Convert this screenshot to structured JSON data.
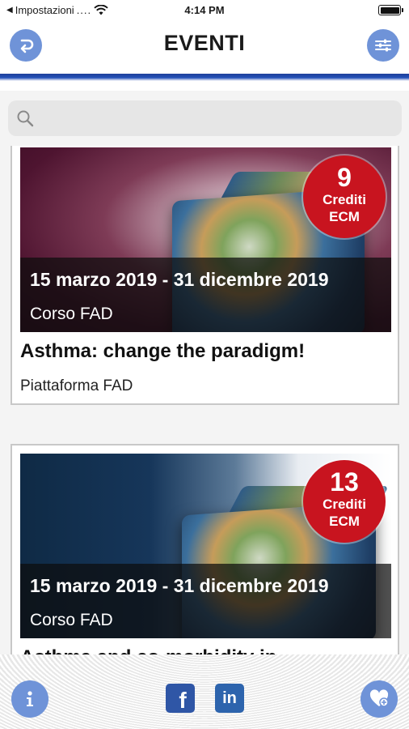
{
  "status_bar": {
    "carrier": "Impostazioni",
    "signal": "....",
    "time": "4:14 PM",
    "battery_level": 1.0
  },
  "header": {
    "title": "EVENTI",
    "back_icon": "back-arrow-icon",
    "filter_icon": "sliders-icon",
    "accent_color": "#6f93d8"
  },
  "search": {
    "placeholder": "",
    "value": ""
  },
  "events": [
    {
      "credits": "9",
      "credits_label_1": "Crediti",
      "credits_label_2": "ECM",
      "dates": "15 marzo 2019 - 31 dicembre 2019",
      "type": "Corso FAD",
      "title": "Asthma: change the paradigm!",
      "platform": "Piattaforma FAD"
    },
    {
      "credits": "13",
      "credits_label_1": "Crediti",
      "credits_label_2": "ECM",
      "dates": "15 marzo 2019 - 31 dicembre 2019",
      "type": "Corso FAD",
      "title": "Asthma and co-morbidity in ...",
      "platform": ""
    }
  ],
  "bottom_bar": {
    "info_icon": "info-icon",
    "facebook_label": "f",
    "linkedin_label": "in",
    "favorites_icon": "heart-icon"
  },
  "colors": {
    "badge": "#c8141f",
    "social": "#2f56a6",
    "rule": "#1e3f9a"
  }
}
